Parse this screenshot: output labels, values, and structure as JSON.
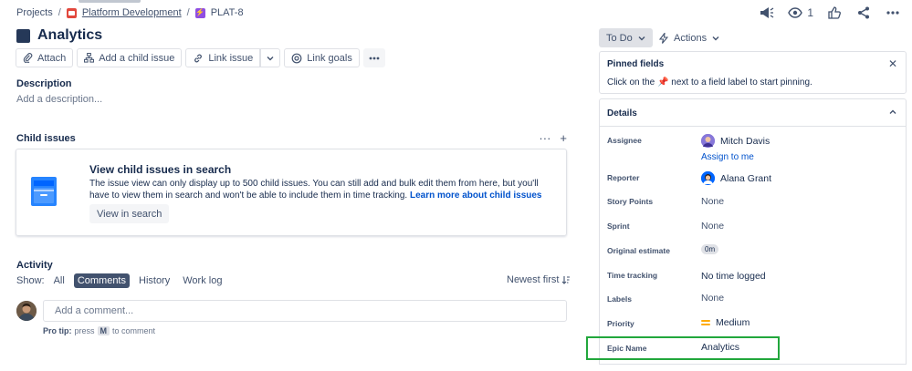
{
  "breadcrumb": {
    "projects": "Projects",
    "sep": "/",
    "project": "Platform Development",
    "issue_key": "PLAT-8"
  },
  "header_actions": {
    "watch_count": "1"
  },
  "issue": {
    "title": "Analytics"
  },
  "toolbar": {
    "attach": "Attach",
    "add_child": "Add a child issue",
    "link_issue": "Link issue",
    "link_goals": "Link goals"
  },
  "description": {
    "label": "Description",
    "placeholder": "Add a description..."
  },
  "child_issues": {
    "label": "Child issues",
    "panel_title": "View child issues in search",
    "panel_text": "The issue view can only display up to 500 child issues. You can still add and bulk edit them from here, but you'll have to view them in search and won't be able to include them in time tracking.",
    "panel_link": "Learn more about child issues",
    "button": "View in search"
  },
  "activity": {
    "label": "Activity",
    "show": "Show:",
    "filters": [
      "All",
      "Comments",
      "History",
      "Work log"
    ],
    "active_filter": "Comments",
    "sort": "Newest first",
    "comment_placeholder": "Add a comment...",
    "protip_prefix": "Pro tip:",
    "protip_press": "press",
    "protip_key": "M",
    "protip_suffix": "to comment"
  },
  "status": {
    "current": "To Do",
    "actions": "Actions"
  },
  "pinned": {
    "title": "Pinned fields",
    "text_before": "Click on the",
    "text_after": "next to a field label to start pinning."
  },
  "details": {
    "title": "Details",
    "fields": {
      "assignee": {
        "label": "Assignee",
        "value": "Mitch Davis",
        "assign_me": "Assign to me"
      },
      "reporter": {
        "label": "Reporter",
        "value": "Alana Grant"
      },
      "story_points": {
        "label": "Story Points",
        "value": "None"
      },
      "sprint": {
        "label": "Sprint",
        "value": "None"
      },
      "original_estimate": {
        "label": "Original estimate",
        "value": "0m"
      },
      "time_tracking": {
        "label": "Time tracking",
        "value": "No time logged"
      },
      "labels": {
        "label": "Labels",
        "value": "None"
      },
      "priority": {
        "label": "Priority",
        "value": "Medium"
      },
      "epic_name": {
        "label": "Epic Name",
        "value": "Analytics"
      }
    }
  },
  "colors": {
    "accent": "#0052cc",
    "highlight": "#22a73c",
    "priority_medium": "#ffab00"
  }
}
